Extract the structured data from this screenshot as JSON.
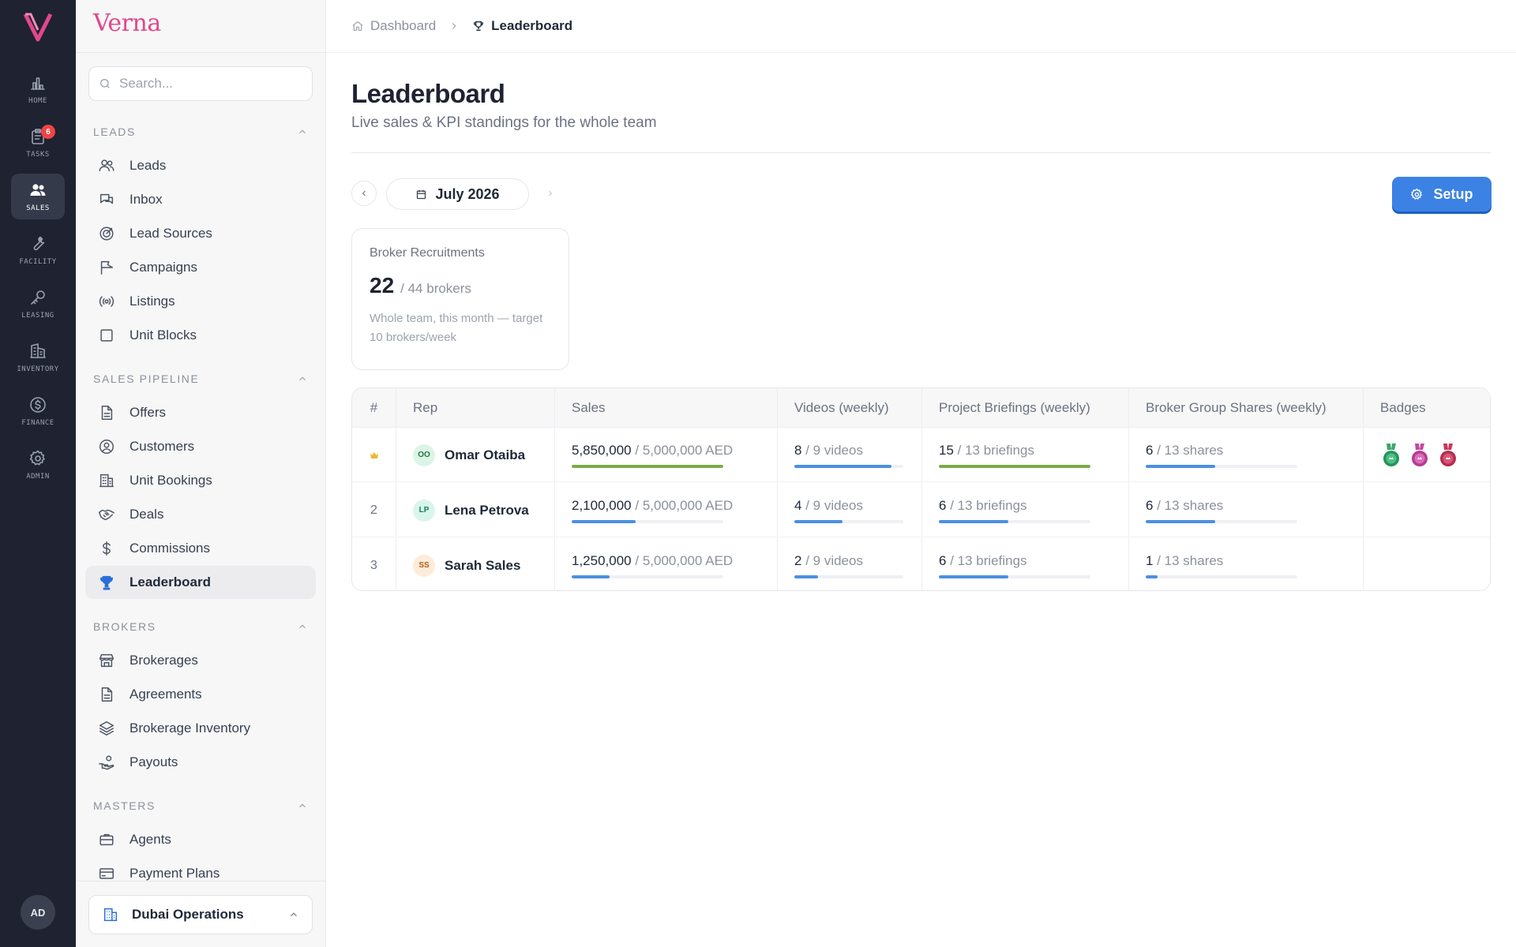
{
  "rail": {
    "items": [
      {
        "label": "HOME",
        "icon": "bar-chart-icon"
      },
      {
        "label": "TASKS",
        "icon": "clipboard-icon",
        "badge": "6"
      },
      {
        "label": "SALES",
        "icon": "users-icon",
        "active": true
      },
      {
        "label": "FACILITY",
        "icon": "wrench-icon"
      },
      {
        "label": "LEASING",
        "icon": "key-icon"
      },
      {
        "label": "INVENTORY",
        "icon": "building-icon"
      },
      {
        "label": "FINANCE",
        "icon": "dollar-circle-icon"
      },
      {
        "label": "ADMIN",
        "icon": "gear-icon"
      }
    ],
    "avatar": "AD"
  },
  "nav": {
    "brand": "Verna",
    "search_placeholder": "Search...",
    "sections": [
      {
        "title": "LEADS",
        "items": [
          "Leads",
          "Inbox",
          "Lead Sources",
          "Campaigns",
          "Listings",
          "Unit Blocks"
        ]
      },
      {
        "title": "SALES PIPELINE",
        "items": [
          "Offers",
          "Customers",
          "Unit Bookings",
          "Deals",
          "Commissions",
          "Leaderboard"
        ]
      },
      {
        "title": "BROKERS",
        "items": [
          "Brokerages",
          "Agreements",
          "Brokerage Inventory",
          "Payouts"
        ]
      },
      {
        "title": "MASTERS",
        "items": [
          "Agents",
          "Payment Plans"
        ]
      }
    ],
    "active_item": "Leaderboard",
    "org": "Dubai Operations"
  },
  "breadcrumb": {
    "home": "Dashboard",
    "current": "Leaderboard"
  },
  "page": {
    "title": "Leaderboard",
    "subtitle": "Live sales & KPI standings for the whole team",
    "month": "July 2026",
    "setup_label": "Setup"
  },
  "kpi": {
    "title": "Broker Recruitments",
    "value": "22",
    "of": "/ 44 brokers",
    "note": "Whole team, this month — target 10 brokers/week"
  },
  "table": {
    "headers": [
      "#",
      "Rep",
      "Sales",
      "Videos (weekly)",
      "Project Briefings (weekly)",
      "Broker Group Shares (weekly)",
      "Badges"
    ],
    "rows": [
      {
        "rank": "",
        "rank_icon": "crown-icon",
        "initials": "OO",
        "name": "Omar Otaiba",
        "sales": "5,850,000",
        "sales_of": "/ 5,000,000 AED",
        "sales_progress": 1.0,
        "sales_color": "#7aab48",
        "videos": "8",
        "videos_of": "/ 9 videos",
        "videos_progress": 0.89,
        "videos_color": "#4a90e2",
        "briefings": "15",
        "briefings_of": "/ 13 briefings",
        "briefings_progress": 1.0,
        "briefings_color": "#7aab48",
        "shares": "6",
        "shares_of": "/ 13 shares",
        "shares_progress": 0.46,
        "shares_color": "#4a90e2",
        "badges": [
          "green-medal-icon",
          "pink-medal-icon",
          "red-medal-icon"
        ]
      },
      {
        "rank": "2",
        "initials": "LP",
        "name": "Lena Petrova",
        "sales": "2,100,000",
        "sales_of": "/ 5,000,000 AED",
        "sales_progress": 0.42,
        "sales_color": "#4a90e2",
        "videos": "4",
        "videos_of": "/ 9 videos",
        "videos_progress": 0.44,
        "videos_color": "#4a90e2",
        "briefings": "6",
        "briefings_of": "/ 13 briefings",
        "briefings_progress": 0.46,
        "briefings_color": "#4a90e2",
        "shares": "6",
        "shares_of": "/ 13 shares",
        "shares_progress": 0.46,
        "shares_color": "#4a90e2",
        "badges": []
      },
      {
        "rank": "3",
        "initials": "SS",
        "name": "Sarah Sales",
        "sales": "1,250,000",
        "sales_of": "/ 5,000,000 AED",
        "sales_progress": 0.25,
        "sales_color": "#4a90e2",
        "videos": "2",
        "videos_of": "/ 9 videos",
        "videos_progress": 0.22,
        "videos_color": "#4a90e2",
        "briefings": "6",
        "briefings_of": "/ 13 briefings",
        "briefings_progress": 0.46,
        "briefings_color": "#4a90e2",
        "shares": "1",
        "shares_of": "/ 13 shares",
        "shares_progress": 0.08,
        "shares_color": "#4a90e2",
        "badges": []
      }
    ]
  }
}
